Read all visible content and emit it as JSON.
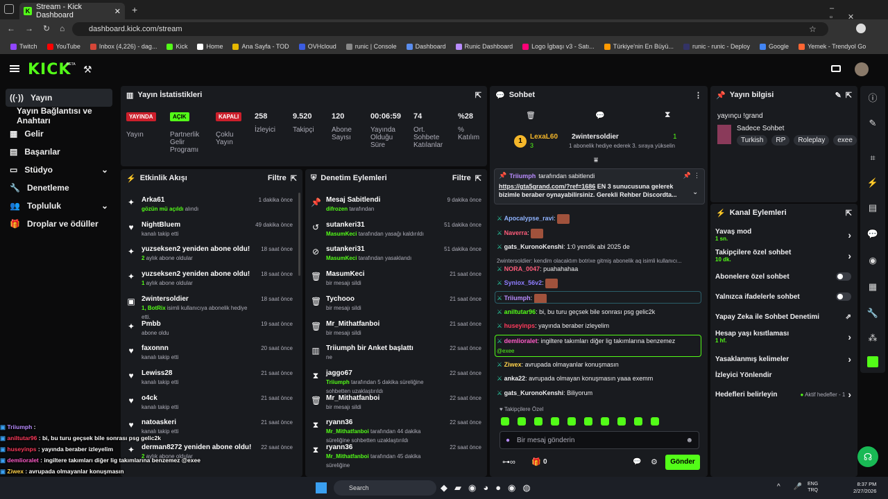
{
  "browser": {
    "tab_title": "Stream - Kick Dashboard",
    "url": "dashboard.kick.com/stream",
    "bookmarks": [
      "Twitch",
      "YouTube",
      "Inbox (4,226) - dag...",
      "Kick",
      "Home",
      "Ana Sayfa - TOD",
      "OVHcloud",
      "runic | Console",
      "Dashboard",
      "Runic Dashboard",
      "Logo İgbaşı v3 - Satı...",
      "Türkiye'nin En Büyü...",
      "runic - runic - Deploy",
      "Google",
      "Yemek - Trendyol Go"
    ]
  },
  "logo": "KICK",
  "logo_beta": "BETA",
  "sidebar": {
    "items": [
      "Yayın",
      "Yayın Bağlantısı ve Anahtarı",
      "Gelir",
      "Başarılar",
      "Stüdyo",
      "Denetleme",
      "Topluluk",
      "Droplar ve ödüller"
    ]
  },
  "stats": {
    "title": "Yayın İstatistikleri",
    "live_badge": "YAYINDA",
    "live_label": "Yayın",
    "partner_badge": "AÇIK",
    "partner_label": "Partnerlik Gelir Programı",
    "multi_badge": "KAPALI",
    "multi_label": "Çoklu Yayın",
    "viewers": "258",
    "viewers_label": "İzleyici",
    "followers": "9.520",
    "followers_label": "Takipçi",
    "subs": "120",
    "subs_label": "Abone Sayısı",
    "uptime": "00:06:59",
    "uptime_label": "Yayında Olduğu Süre",
    "chatters": "74",
    "chatters_label": "Ort. Sohbete Katılanlar",
    "participation": "%28",
    "participation_label": "% Katılım"
  },
  "activity": {
    "title": "Etkinlik Akışı",
    "filter": "Filtre",
    "items": [
      {
        "icon": "✦",
        "name": "Arka61",
        "sub_hl": "gözün mü açıldı",
        "sub": " alındı",
        "time": "1 dakika önce"
      },
      {
        "icon": "♥",
        "name": "NightBluem",
        "sub_hl": "",
        "sub": "kanalı takip etti",
        "time": "49 dakika önce"
      },
      {
        "icon": "✦",
        "name": "yuzseksen2 yeniden abone oldu!",
        "sub_hl": "2",
        "sub": " aylık abone oldular",
        "time": "18 saat önce"
      },
      {
        "icon": "✦",
        "name": "yuzseksen2 yeniden abone oldu!",
        "sub_hl": "1",
        "sub": " aylık abone oldular",
        "time": "18 saat önce"
      },
      {
        "icon": "▣",
        "name": "2wintersoldier",
        "sub_hl": "1, BotRix",
        "sub": " isimli kullanıcıya abonelik hediye etti.",
        "time": "18 saat önce"
      },
      {
        "icon": "✦",
        "name": "Pmbb",
        "sub_hl": "",
        "sub": "abone oldu",
        "time": "19 saat önce"
      },
      {
        "icon": "♥",
        "name": "faxonnn",
        "sub_hl": "",
        "sub": "kanalı takip etti",
        "time": "20 saat önce"
      },
      {
        "icon": "♥",
        "name": "Lewiss28",
        "sub_hl": "",
        "sub": "kanalı takip etti",
        "time": "21 saat önce"
      },
      {
        "icon": "♥",
        "name": "o4ck",
        "sub_hl": "",
        "sub": "kanalı takip etti",
        "time": "21 saat önce"
      },
      {
        "icon": "♥",
        "name": "natoaskeri",
        "sub_hl": "",
        "sub": "kanalı takip etti",
        "time": "21 saat önce"
      },
      {
        "icon": "✦",
        "name": "derman8272 yeniden abone oldu!",
        "sub_hl": "2",
        "sub": " aylık abone oldular",
        "time": "22 saat önce"
      }
    ]
  },
  "moderation": {
    "title": "Denetim Eylemleri",
    "filter": "Filtre",
    "items": [
      {
        "icon": "📌",
        "name": "Mesaj Sabitlendi",
        "sub_hl": "difrozen",
        "sub": " tarafından",
        "time": "9 dakika önce"
      },
      {
        "icon": "↺",
        "name": "sutankeri31",
        "sub_hl": "MasumKeci",
        "sub": " tarafından yasağı kaldırıldı",
        "time": "51 dakika önce"
      },
      {
        "icon": "⊘",
        "name": "sutankeri31",
        "sub_hl": "MasumKeci",
        "sub": " tarafından yasaklandı",
        "time": "51 dakika önce"
      },
      {
        "icon": "🗑",
        "name": "MasumKeci",
        "sub_hl": "",
        "sub": "bir mesajı sildi",
        "time": "21 saat önce"
      },
      {
        "icon": "🗑",
        "name": "Tychooo",
        "sub_hl": "",
        "sub": "bir mesajı sildi",
        "time": "21 saat önce"
      },
      {
        "icon": "🗑",
        "name": "Mr_Mithatfanboi",
        "sub_hl": "",
        "sub": "bir mesajı sildi",
        "time": "21 saat önce"
      },
      {
        "icon": "▥",
        "name": "Triiumph bir Anket başlattı",
        "sub_hl": "",
        "sub": "ne",
        "time": "22 saat önce"
      },
      {
        "icon": "⧗",
        "name": "jaggo67",
        "sub_hl": "Triiumph",
        "sub": " tarafından 5 dakika süreliğine sohbetten uzaklaştırıldı",
        "time": "22 saat önce"
      },
      {
        "icon": "🗑",
        "name": "Mr_Mithatfanboi",
        "sub_hl": "",
        "sub": "bir mesajı sildi",
        "time": "22 saat önce"
      },
      {
        "icon": "⧗",
        "name": "ryann36",
        "sub_hl": "Mr_Mithatfanboi",
        "sub": " tarafından 44 dakika süreliğine sohbetten uzaklaştırıldı",
        "time": "22 saat önce"
      },
      {
        "icon": "⧗",
        "name": "ryann36",
        "sub_hl": "Mr_Mithatfanboi",
        "sub": " tarafından 45 dakika süreliğine",
        "time": "22 saat önce"
      }
    ]
  },
  "chat": {
    "title": "Sohbet",
    "gifter1": "LexaL60",
    "gifter1_count": "3",
    "gifter2": "2wintersoldier",
    "gifter2_count": "1",
    "gifter_note": "1 abonelik hediye ederek 3. sıraya yükselin",
    "pinned_by": "Triiumph",
    "pinned_suffix": "tarafından sabitlendi",
    "pinned_link": "https://gta5grand.com/?ref=1686",
    "pinned_text": " EN 3 sunucusuna gelerek bizimle beraber oynayabilirsiniz. Gerekli Rehber Discordta...",
    "messages": [
      {
        "user": "Apocalypse_ravi",
        "color": "#8fb3ff",
        "text": ""
      },
      {
        "user": "Naverra",
        "color": "#ff5c7a",
        "text": ""
      },
      {
        "user": "gats_KuronoKenshi",
        "color": "#efeff1",
        "text": "1:0 yendik abi 2025 de"
      },
      {
        "user": "",
        "color": "#adadb8",
        "text": "2wintersoldier: kendim olacaktım botrixe gitmiş abonelik aq isimli kullanıcı..."
      },
      {
        "user": "NORA_0047",
        "color": "#ff5c7a",
        "text": "puahahahaa"
      },
      {
        "user": "Syniox_56v2",
        "color": "#8f7dff",
        "text": ""
      },
      {
        "user": "Triiumph",
        "color": "#b98cff",
        "text": ""
      },
      {
        "user": "aniltutar96",
        "color": "#53fc18",
        "text": "bi, bu turu geçsek bile sonrası psg gelic2k"
      },
      {
        "user": "huseyinps",
        "color": "#ff3b5c",
        "text": "yayında beraber izleyelim"
      },
      {
        "user": "demlioralet",
        "color": "#ff5cc8",
        "text": "ingiltere takımları diğer lig takımlarına benzemez"
      },
      {
        "user": "",
        "color": "#53fc18",
        "text": "@exee"
      },
      {
        "user": "Ziwex",
        "color": "#ffd24a",
        "text": "avrupada olmayanlar konuşmasın"
      },
      {
        "user": "anka22",
        "color": "#efeff1",
        "text": "avrupada olmayan konuşmasın yaaa exemm"
      },
      {
        "user": "gats_KuronoKenshi",
        "color": "#efeff1",
        "text": "Biliyorum"
      }
    ],
    "followers_only": "Takipçilere Özel",
    "placeholder": "Bir mesaj gönderin",
    "points": "0",
    "send": "Gönder"
  },
  "info": {
    "title": "Yayın bilgisi",
    "stream_title": "yayınçu !grand",
    "category": "Sadece Sohbet",
    "tags": [
      "Turkish",
      "RP",
      "Roleplay",
      "exee"
    ]
  },
  "channel_actions": {
    "title": "Kanal Eylemleri",
    "slow": "Yavaş mod",
    "slow_val": "1 sn.",
    "followers_chat": "Takipçilere özel sohbet",
    "followers_val": "10 dk.",
    "subs_chat": "Abonelere özel sohbet",
    "emote_chat": "Yalnızca ifadelerle sohbet",
    "ai_mod": "Yapay Zeka ile Sohbet Denetimi",
    "age": "Hesap yaşı kısıtlaması",
    "age_val": "1 hf.",
    "banned": "Yasaklanmış kelimeler",
    "redirect": "İzleyici Yönlendir",
    "goals": "Hedefleri belirleyin",
    "goals_active": "Aktif hedefler - 1"
  },
  "overlay": [
    {
      "user": "Triiumph",
      "color": "#b98cff",
      "text": ""
    },
    {
      "user": "aniltutar96",
      "color": "#ff3b5c",
      "text": "bi, bu turu geçsek bile sonrası psg gelic2k"
    },
    {
      "user": "huseyinps",
      "color": "#ff3b5c",
      "text": "yayında beraber izleyelim"
    },
    {
      "user": "demlioralet",
      "color": "#ff5cc8",
      "text": "ingiltere takımları diğer lig takımlarına benzemez  @exee"
    },
    {
      "user": "Ziwex",
      "color": "#ffd24a",
      "text": "avrupada olmayanlar konuşmasın"
    },
    {
      "user": "anka22",
      "color": "#efeff1",
      "text": "avrupada olmayan konuşmasın yaaa exemm"
    },
    {
      "user": "gats_KuronoKenshi",
      "color": "#efeff1",
      "text": "Biliyorum"
    }
  ],
  "taskbar": {
    "search": "Search",
    "lang1": "ENG",
    "lang2": "TRQ",
    "time": "8:37 PM",
    "date": "2/27/2026"
  }
}
